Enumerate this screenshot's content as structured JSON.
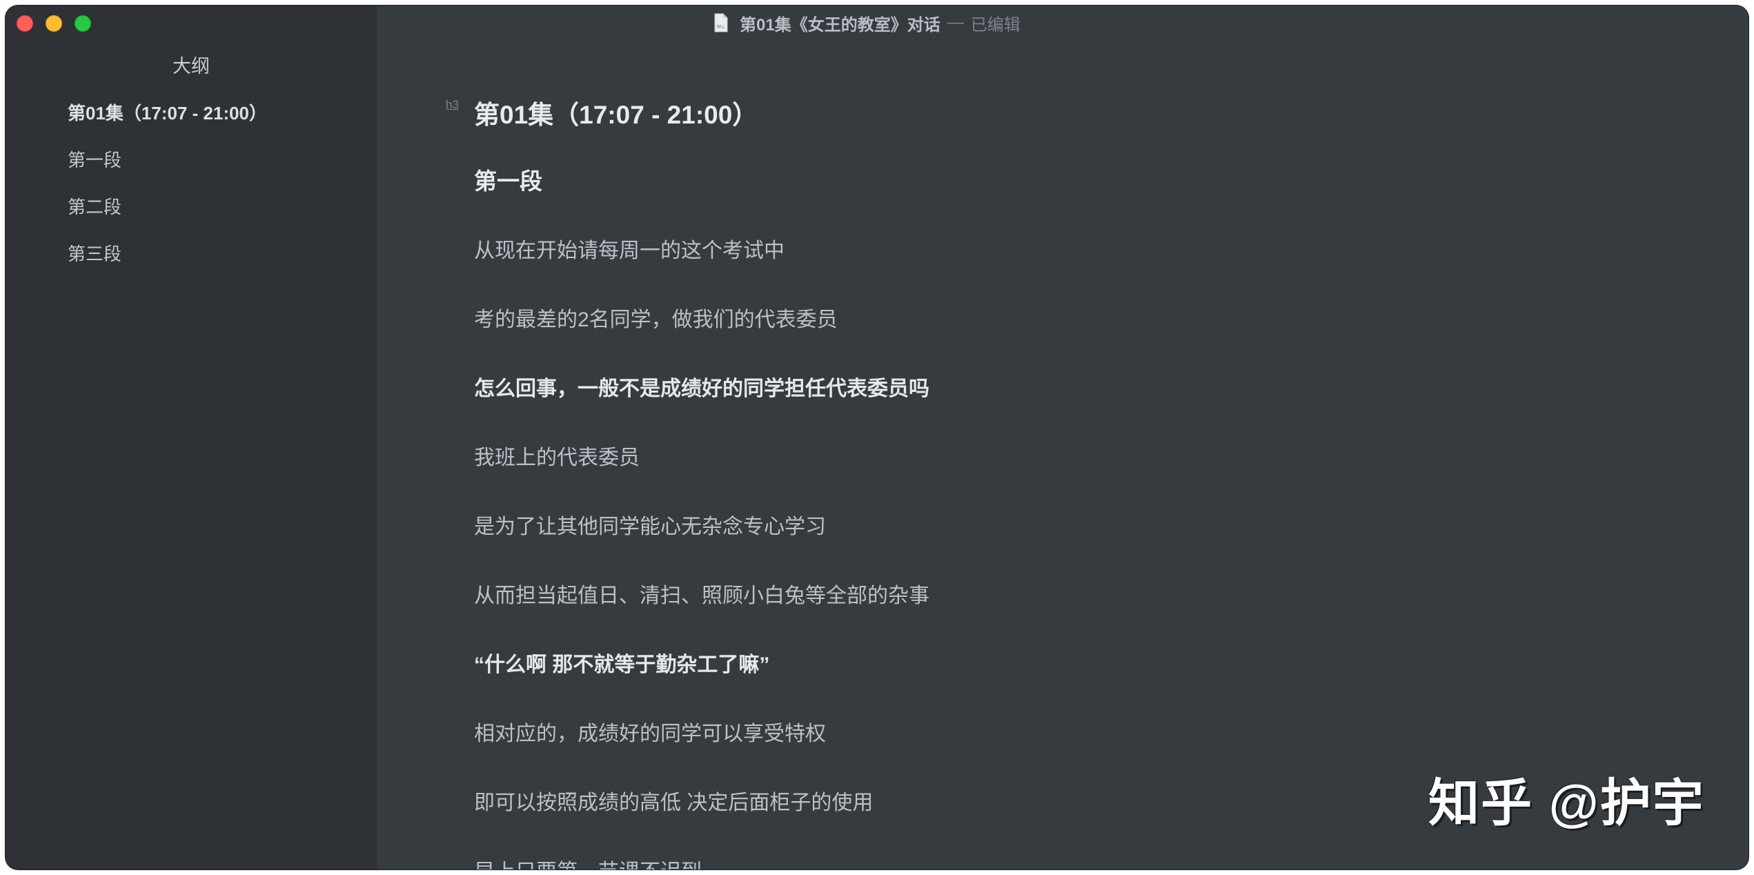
{
  "window": {
    "title": "第01集《女王的教室》对话",
    "title_separator": "—",
    "title_status": "已编辑",
    "file_icon": "markdown-file-icon"
  },
  "sidebar": {
    "title": "大纲",
    "items": [
      {
        "label": "第01集（17:07 - 21:00）",
        "active": true
      },
      {
        "label": "第一段",
        "active": false
      },
      {
        "label": "第二段",
        "active": false
      },
      {
        "label": "第三段",
        "active": false
      }
    ]
  },
  "editor": {
    "heading_tag": "h3",
    "heading": "第01集（17:07 - 21:00）",
    "subheading": "第一段",
    "paragraphs": [
      {
        "text": "从现在开始请每周一的这个考试中",
        "bold": false
      },
      {
        "text": "考的最差的2名同学，做我们的代表委员",
        "bold": false
      },
      {
        "text": "怎么回事，一般不是成绩好的同学担任代表委员吗",
        "bold": true
      },
      {
        "text": "我班上的代表委员",
        "bold": false
      },
      {
        "text": "是为了让其他同学能心无杂念专心学习",
        "bold": false
      },
      {
        "text": "从而担当起值日、清扫、照顾小白兔等全部的杂事",
        "bold": false
      },
      {
        "text": "“什么啊 那不就等于勤杂工了嘛”",
        "bold": true
      },
      {
        "text": "相对应的，成绩好的同学可以享受特权",
        "bold": false
      },
      {
        "text": "即可以按照成绩的高低 决定后面柜子的使用",
        "bold": false
      },
      {
        "text": "早上只要第一节课不迟到",
        "bold": false
      }
    ]
  },
  "watermark": "知乎 @护宇",
  "colors": {
    "sidebar_bg": "#2e3136",
    "editor_bg": "#363b40",
    "close": "#ff5f57",
    "minimize": "#febc2e",
    "zoom": "#28c840"
  }
}
